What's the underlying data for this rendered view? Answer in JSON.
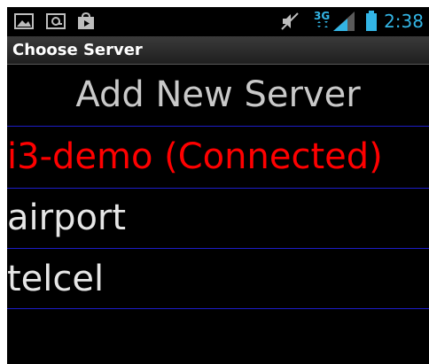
{
  "status_bar": {
    "time": "2:38",
    "network_label": "3G",
    "icons": [
      "gallery-icon",
      "voicemail-icon",
      "store-icon",
      "mute-icon",
      "signal-icon",
      "battery-icon"
    ]
  },
  "title_bar": {
    "title": "Choose Server"
  },
  "actions": {
    "add_server_label": "Add New Server"
  },
  "servers": [
    {
      "label": "i3-demo (Connected)",
      "connected": true
    },
    {
      "label": "airport",
      "connected": false
    },
    {
      "label": "telcel",
      "connected": false
    }
  ],
  "colors": {
    "background": "#000000",
    "divider": "#1d1dc8",
    "connected_text": "#ff0000",
    "normal_text": "#e6e6e6",
    "clock": "#33b5e5"
  }
}
